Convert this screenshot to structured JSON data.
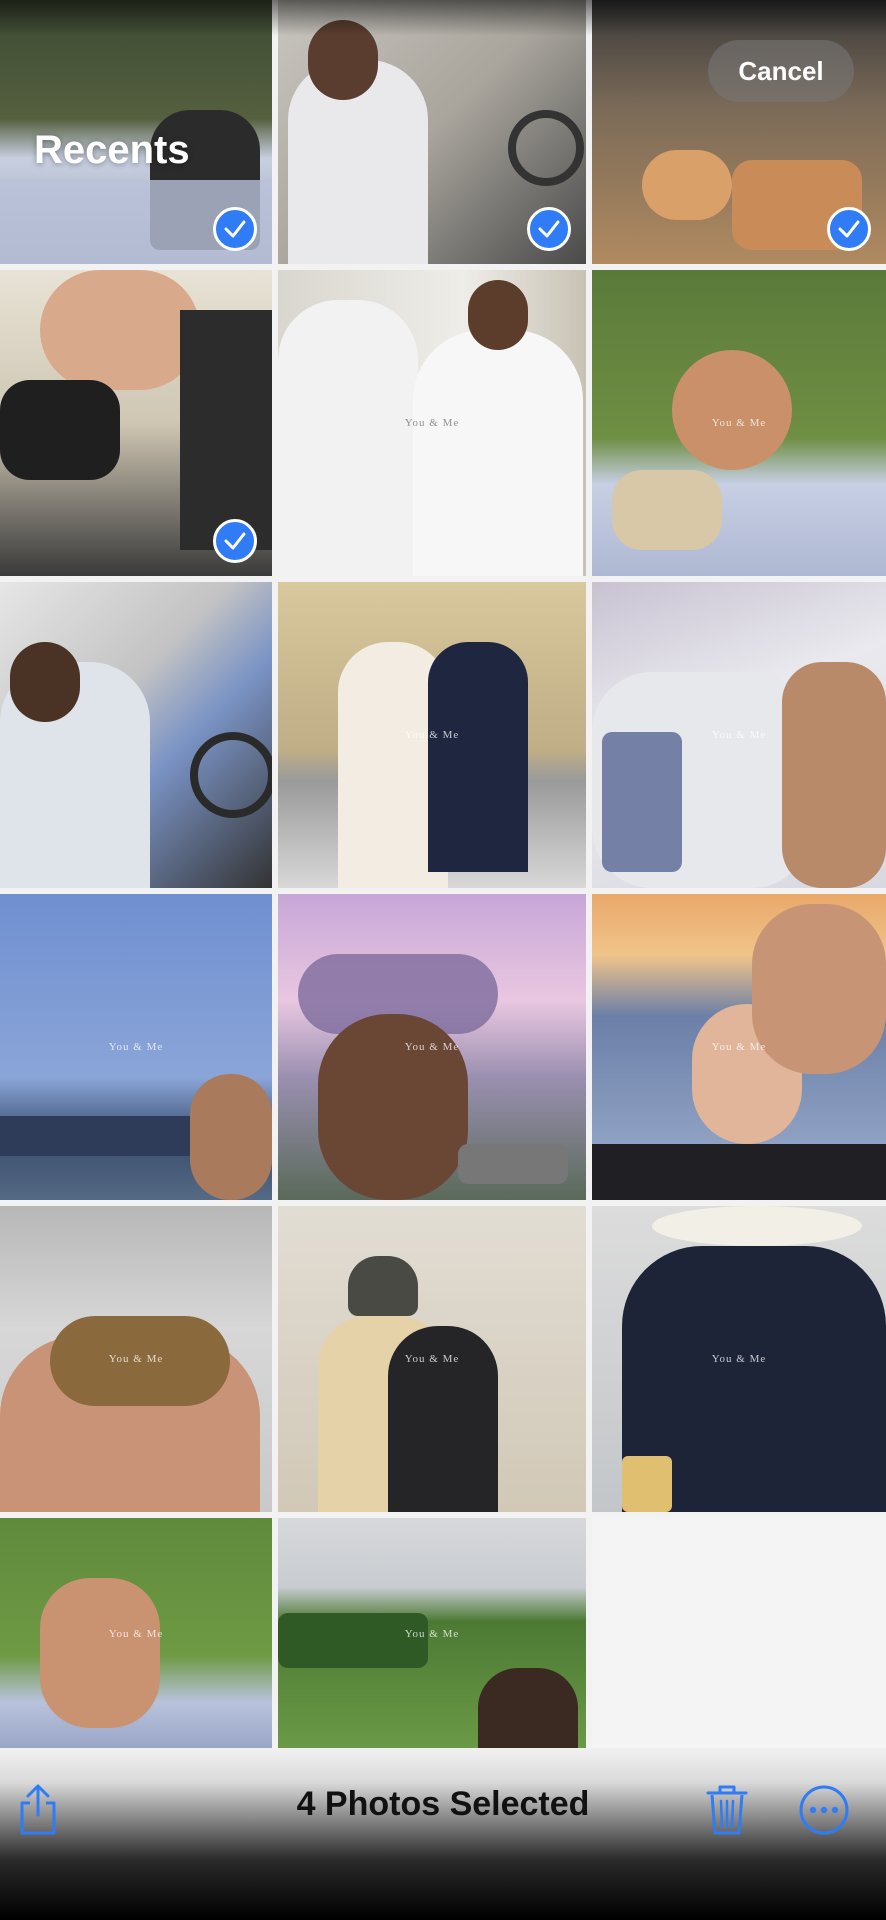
{
  "header": {
    "title": "Recents",
    "cancel_label": "Cancel"
  },
  "watermark": "You & Me",
  "toolbar": {
    "selection_label": "4 Photos Selected",
    "share_icon": "share-icon",
    "delete_icon": "trash-icon",
    "more_icon": "ellipsis-circle-icon"
  },
  "colors": {
    "accent": "#2f7cf6"
  },
  "photos": [
    {
      "row": 1,
      "col": 1,
      "selected": true
    },
    {
      "row": 1,
      "col": 2,
      "selected": true
    },
    {
      "row": 1,
      "col": 3,
      "selected": true
    },
    {
      "row": 2,
      "col": 1,
      "selected": true
    },
    {
      "row": 2,
      "col": 2,
      "selected": false
    },
    {
      "row": 2,
      "col": 3,
      "selected": false
    },
    {
      "row": 3,
      "col": 1,
      "selected": false
    },
    {
      "row": 3,
      "col": 2,
      "selected": false
    },
    {
      "row": 3,
      "col": 3,
      "selected": false
    },
    {
      "row": 4,
      "col": 1,
      "selected": false
    },
    {
      "row": 4,
      "col": 2,
      "selected": false
    },
    {
      "row": 4,
      "col": 3,
      "selected": false
    },
    {
      "row": 5,
      "col": 1,
      "selected": false
    },
    {
      "row": 5,
      "col": 2,
      "selected": false
    },
    {
      "row": 5,
      "col": 3,
      "selected": false
    },
    {
      "row": 6,
      "col": 1,
      "selected": false
    },
    {
      "row": 6,
      "col": 2,
      "selected": false
    }
  ]
}
